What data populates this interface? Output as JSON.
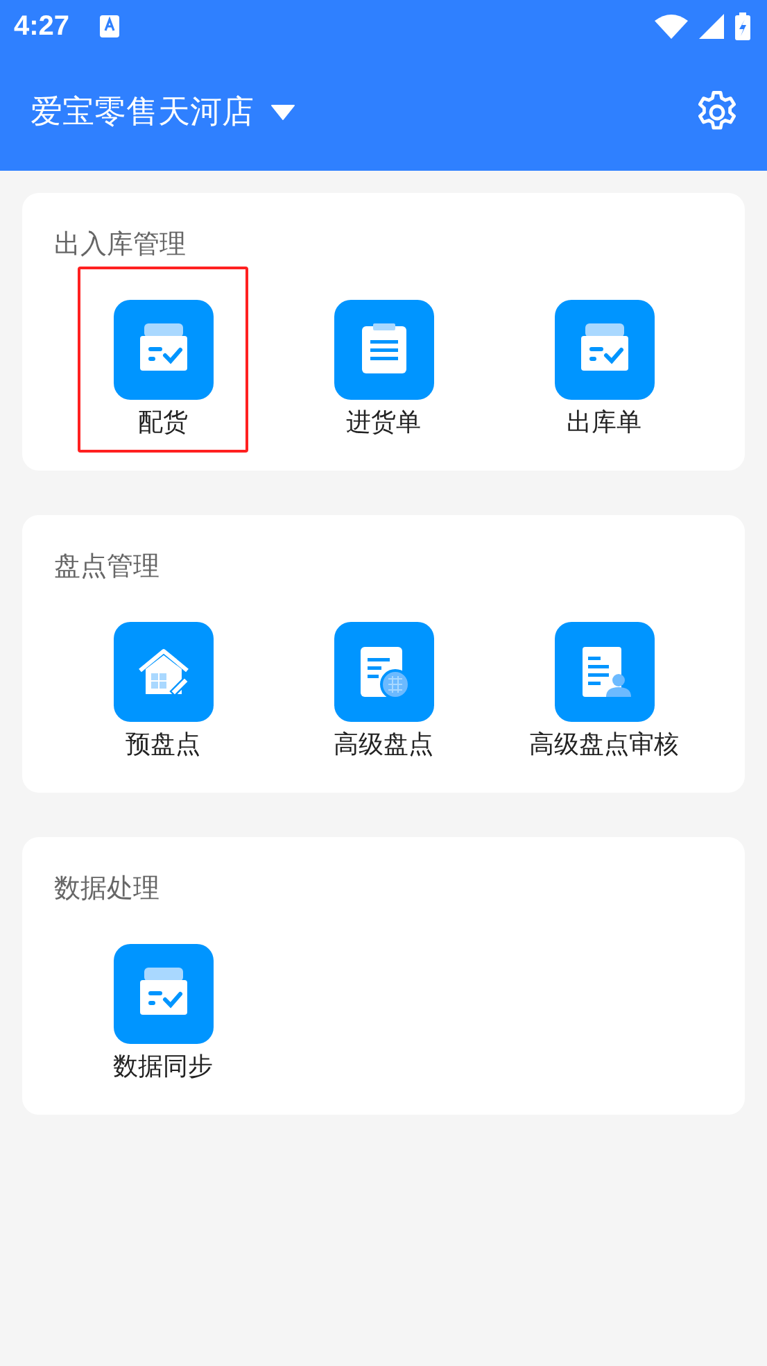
{
  "status_bar": {
    "time": "4:27"
  },
  "app_bar": {
    "store": "爱宝零售天河店"
  },
  "sections": [
    {
      "title": "出入库管理",
      "items": [
        {
          "label": "配货",
          "kind": "box",
          "highlighted": true
        },
        {
          "label": "进货单",
          "kind": "clipboard",
          "highlighted": false
        },
        {
          "label": "出库单",
          "kind": "box",
          "highlighted": false
        }
      ]
    },
    {
      "title": "盘点管理",
      "items": [
        {
          "label": "预盘点",
          "kind": "house",
          "highlighted": false
        },
        {
          "label": "高级盘点",
          "kind": "stamp",
          "highlighted": false
        },
        {
          "label": "高级盘点审核",
          "kind": "person",
          "highlighted": false
        }
      ]
    },
    {
      "title": "数据处理",
      "items": [
        {
          "label": "数据同步",
          "kind": "box",
          "highlighted": false
        }
      ]
    }
  ]
}
